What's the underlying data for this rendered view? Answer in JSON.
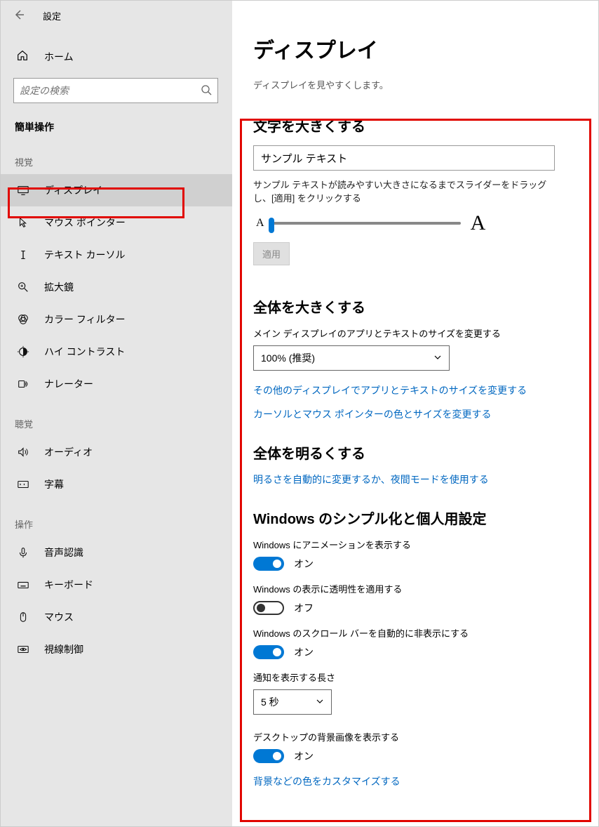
{
  "titlebar": {
    "title": "設定"
  },
  "sidebar": {
    "home": "ホーム",
    "search_placeholder": "設定の検索",
    "section": "簡単操作",
    "groups": [
      {
        "label": "視覚",
        "items": [
          {
            "id": "display",
            "label": "ディスプレイ",
            "selected": true
          },
          {
            "id": "cursor",
            "label": "マウス ポインター"
          },
          {
            "id": "textcursor",
            "label": "テキスト カーソル"
          },
          {
            "id": "magnifier",
            "label": "拡大鏡"
          },
          {
            "id": "colorfilter",
            "label": "カラー フィルター"
          },
          {
            "id": "highcontrast",
            "label": "ハイ コントラスト"
          },
          {
            "id": "narrator",
            "label": "ナレーター"
          }
        ]
      },
      {
        "label": "聴覚",
        "items": [
          {
            "id": "audio",
            "label": "オーディオ"
          },
          {
            "id": "caption",
            "label": "字幕"
          }
        ]
      },
      {
        "label": "操作",
        "items": [
          {
            "id": "speech",
            "label": "音声認識"
          },
          {
            "id": "keyboard",
            "label": "キーボード"
          },
          {
            "id": "mouse",
            "label": "マウス"
          },
          {
            "id": "eyectrl",
            "label": "視線制御"
          }
        ]
      }
    ]
  },
  "content": {
    "title": "ディスプレイ",
    "subtitle": "ディスプレイを見やすくします。",
    "textsize": {
      "heading": "文字を大きくする",
      "sample": "サンプル テキスト",
      "desc": "サンプル テキストが読みやすい大きさになるまでスライダーをドラッグし、[適用] をクリックする",
      "apply": "適用"
    },
    "everything": {
      "heading": "全体を大きくする",
      "desc": "メイン ディスプレイのアプリとテキストのサイズを変更する",
      "value": "100% (推奨)",
      "link1": "その他のディスプレイでアプリとテキストのサイズを変更する",
      "link2": "カーソルとマウス ポインターの色とサイズを変更する"
    },
    "brightness": {
      "heading": "全体を明るくする",
      "link": "明るさを自動的に変更するか、夜間モードを使用する"
    },
    "simplify": {
      "heading": "Windows のシンプル化と個人用設定",
      "anim_label": "Windows にアニメーションを表示する",
      "anim_state": "オン",
      "trans_label": "Windows の表示に透明性を適用する",
      "trans_state": "オフ",
      "scroll_label": "Windows のスクロール バーを自動的に非表示にする",
      "scroll_state": "オン",
      "notif_label": "通知を表示する長さ",
      "notif_value": "5 秒",
      "bg_label": "デスクトップの背景画像を表示する",
      "bg_state": "オン",
      "bg_link": "背景などの色をカスタマイズする"
    }
  }
}
